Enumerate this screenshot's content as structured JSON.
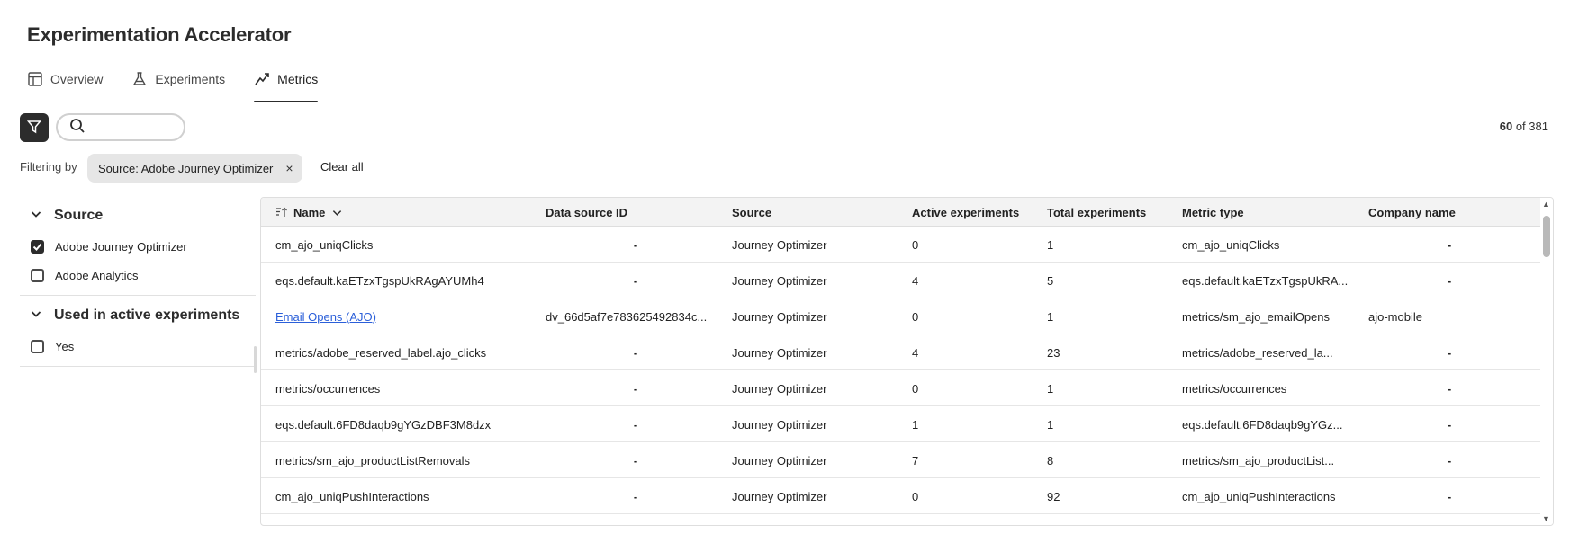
{
  "app": {
    "title": "Experimentation Accelerator"
  },
  "tabs": [
    {
      "label": "Overview",
      "icon": "layout-icon"
    },
    {
      "label": "Experiments",
      "icon": "beaker-icon"
    },
    {
      "label": "Metrics",
      "icon": "trend-icon",
      "active": true
    }
  ],
  "search": {
    "placeholder": "",
    "value": ""
  },
  "count": {
    "shown": "60",
    "separator": " of ",
    "total": "381"
  },
  "filters": {
    "label": "Filtering by",
    "chip": "Source: Adobe Journey Optimizer",
    "chip_close": "×",
    "clear_all": "Clear all"
  },
  "sidebar": {
    "facets": [
      {
        "title": "Source",
        "options": [
          {
            "label": "Adobe Journey Optimizer",
            "checked": true
          },
          {
            "label": "Adobe Analytics",
            "checked": false
          }
        ]
      },
      {
        "title": "Used in active experiments",
        "options": [
          {
            "label": "Yes",
            "checked": false
          }
        ]
      }
    ]
  },
  "table": {
    "columns": [
      "Name",
      "Data source ID",
      "Source",
      "Active experiments",
      "Total experiments",
      "Metric type",
      "Company name"
    ],
    "rows": [
      [
        "cm_ajo_uniqClicks",
        "-",
        "Journey Optimizer",
        "0",
        "1",
        "cm_ajo_uniqClicks",
        "-"
      ],
      [
        "eqs.default.kaETzxTgspUkRAgAYUMh4",
        "-",
        "Journey Optimizer",
        "4",
        "5",
        "eqs.default.kaETzxTgspUkRA...",
        "-"
      ],
      [
        "Email Opens (AJO)",
        "dv_66d5af7e783625492834c...",
        "Journey Optimizer",
        "0",
        "1",
        "metrics/sm_ajo_emailOpens",
        "ajo-mobile"
      ],
      [
        "metrics/adobe_reserved_label.ajo_clicks",
        "-",
        "Journey Optimizer",
        "4",
        "23",
        "metrics/adobe_reserved_la...",
        "-"
      ],
      [
        "metrics/occurrences",
        "-",
        "Journey Optimizer",
        "0",
        "1",
        "metrics/occurrences",
        "-"
      ],
      [
        "eqs.default.6FD8daqb9gYGzDBF3M8dzx",
        "-",
        "Journey Optimizer",
        "1",
        "1",
        "eqs.default.6FD8daqb9gYGz...",
        "-"
      ],
      [
        "metrics/sm_ajo_productListRemovals",
        "-",
        "Journey Optimizer",
        "7",
        "8",
        "metrics/sm_ajo_productList...",
        "-"
      ],
      [
        "cm_ajo_uniqPushInteractions",
        "-",
        "Journey Optimizer",
        "0",
        "92",
        "cm_ajo_uniqPushInteractions",
        "-"
      ]
    ]
  },
  "colors": {
    "link": "#2b5fd9",
    "dark": "#2c2c2c",
    "header_bg": "#f3f3f3"
  }
}
